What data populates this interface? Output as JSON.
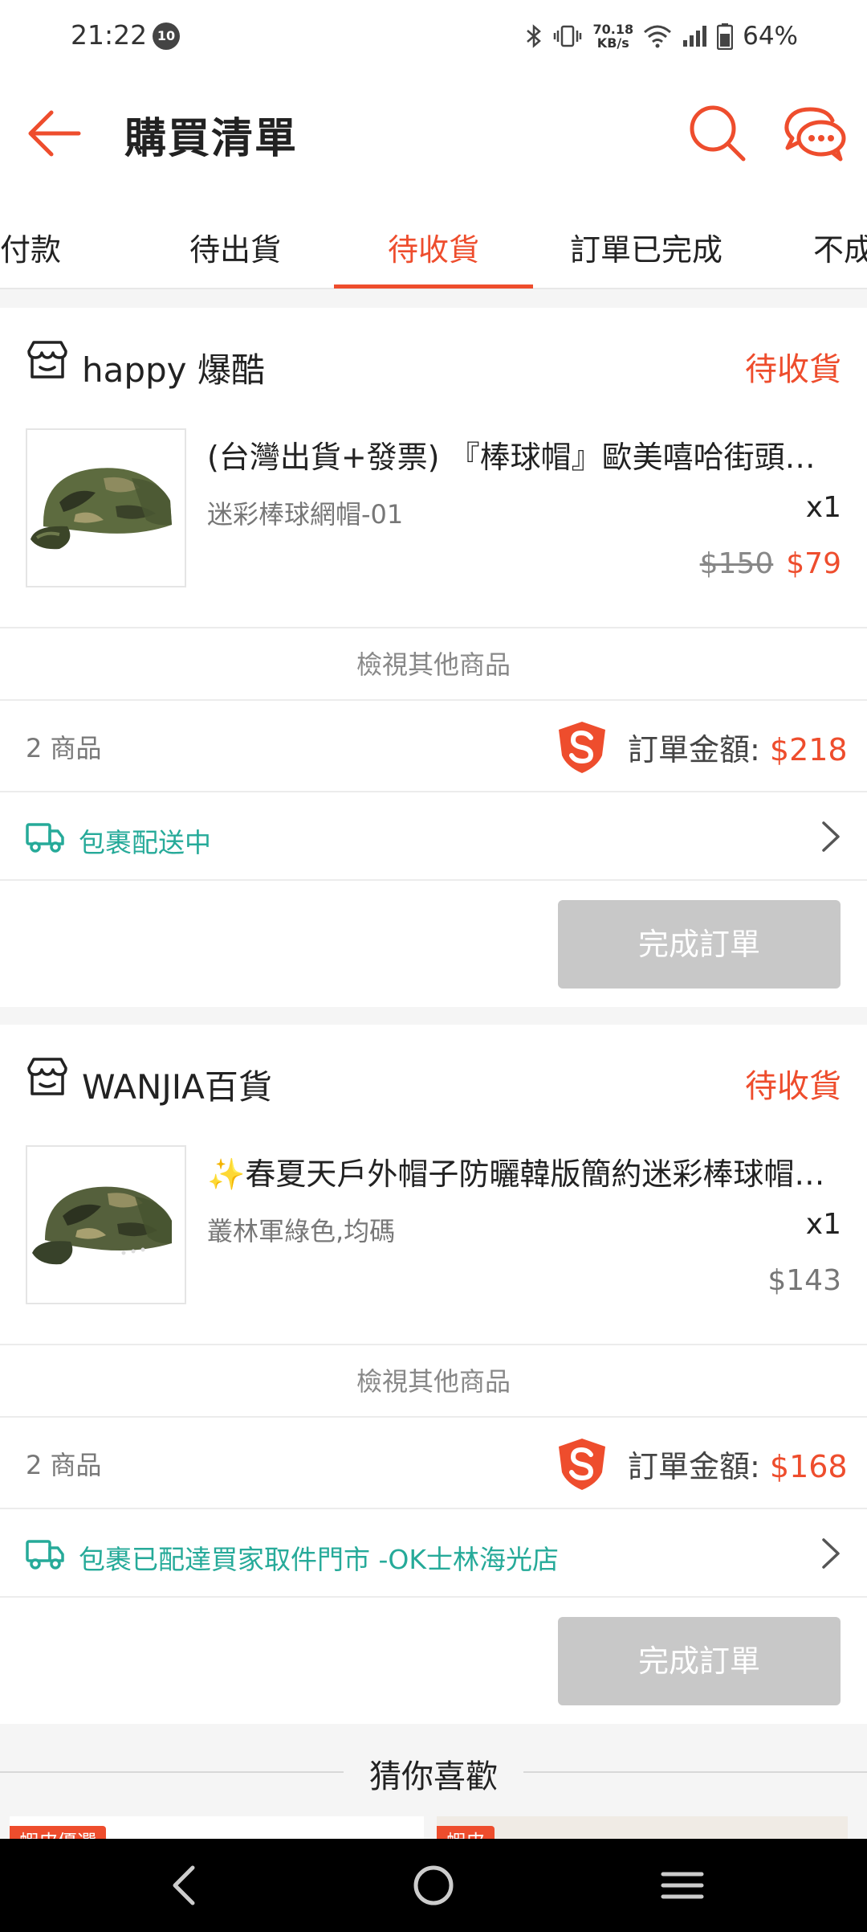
{
  "status_bar": {
    "time": "21:22",
    "badge": "10",
    "net_speed_value": "70.18",
    "net_speed_unit": "KB/s",
    "battery": "64%"
  },
  "header": {
    "title": "購買清單",
    "back_icon": "arrow-left-icon",
    "search_icon": "search-icon",
    "chat_icon": "chat-bubbles-icon"
  },
  "tabs": [
    {
      "label": "待付款"
    },
    {
      "label": "待出貨"
    },
    {
      "label": "待收貨",
      "active": true
    },
    {
      "label": "訂單已完成"
    },
    {
      "label": "不成立"
    }
  ],
  "orders": [
    {
      "shop_name": "happy 爆酷",
      "status": "待收貨",
      "item": {
        "title": "(台灣出貨+發票) 『棒球帽』歐美嘻哈街頭潮流",
        "variant": "迷彩棒球網帽-01",
        "qty": "x1",
        "original_price": "$150",
        "price": "$79"
      },
      "view_more": "檢視其他商品",
      "item_count": "2 商品",
      "total_label": "訂單金額:",
      "total": "$218",
      "shipping_status": "包裹配送中",
      "button": "完成訂單"
    },
    {
      "shop_name": "WANJIA百貨",
      "status": "待收貨",
      "item": {
        "title": "✨春夏天戶外帽子防曬韓版簡約迷彩棒球帽男女",
        "variant": "叢林軍綠色,均碼",
        "qty": "x1",
        "price": "$143"
      },
      "view_more": "檢視其他商品",
      "item_count": "2 商品",
      "total_label": "訂單金額:",
      "total": "$168",
      "shipping_status": "包裹已配達買家取件門市 -OK士林海光店",
      "button": "完成訂單"
    }
  ],
  "recommendations": {
    "title": "猜你喜歡",
    "tag_left": "蝦皮優選",
    "tag_right": "蝦皮"
  },
  "colors": {
    "accent": "#ee4d2d",
    "shipping": "#26aa99",
    "disabled_button": "#c8c8c8"
  }
}
